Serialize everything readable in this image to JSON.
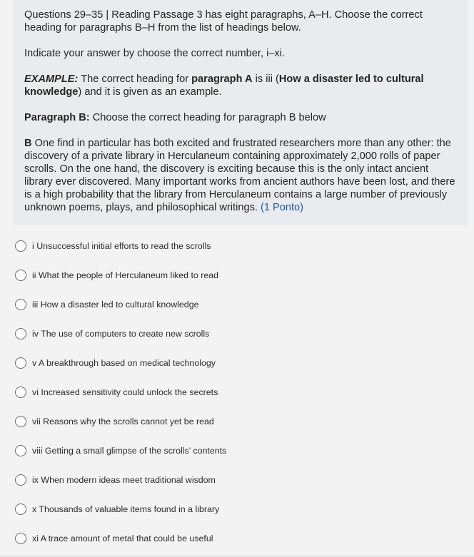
{
  "question": {
    "title": "Questions 29–35 | Reading Passage 3 has eight paragraphs, A–H. Choose the correct heading for paragraphs B–H from the list of headings below.",
    "instruction": "Indicate your answer by choose the correct number, i–xi.",
    "example": {
      "label": "EXAMPLE:",
      "text_1": " The correct heading for ",
      "para_bold": "paragraph A",
      "text_2": " is iii (",
      "heading_bold": "How a disaster led to cultural knowledge",
      "text_3": ") and it is given as an example."
    },
    "paragraph_prompt": {
      "label": "Paragraph B:",
      "text": " Choose the correct heading for paragraph B below"
    },
    "passage": {
      "letter": "B",
      "text": " One find in particular has both excited and frustrated researchers more than any other: the discovery of a private library in Herculaneum containing approximately 2,000 rolls of paper scrolls. On the one hand, the discovery is exciting because this is the only intact ancient library ever discovered. Many important works from ancient authors have been lost, and there is a high probability that the library from Herculaneum contains a large number of previously unknown poems, plays, and philosophical writings. ",
      "points": "(1 Ponto)"
    }
  },
  "options": [
    {
      "label": "i Unsuccessful initial efforts to read the scrolls"
    },
    {
      "label": "ii What the people of Herculaneum liked to read"
    },
    {
      "label": "iii How a disaster led to cultural knowledge"
    },
    {
      "label": "iv The use of computers to create new scrolls"
    },
    {
      "label": "v A breakthrough based on medical technology"
    },
    {
      "label": "vi Increased sensitivity could unlock the secrets"
    },
    {
      "label": "vii Reasons why the scrolls cannot yet be read"
    },
    {
      "label": "viii Getting a small glimpse of the scrolls’ contents"
    },
    {
      "label": "ix When modern ideas meet traditional wisdom"
    },
    {
      "label": "x Thousands of valuable items found in a library"
    },
    {
      "label": "xi A trace amount of metal that could be useful"
    }
  ],
  "colors": {
    "accent": "#1f5aa6",
    "card_background": "#e9ebee",
    "page_background": "#f3f3f3"
  }
}
